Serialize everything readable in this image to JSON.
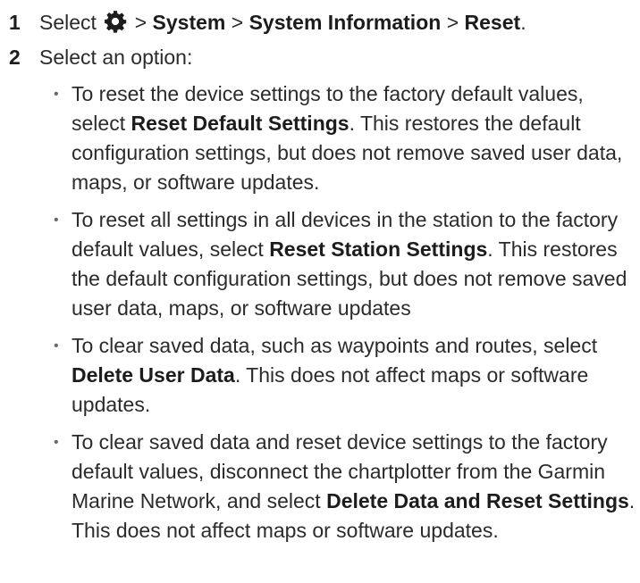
{
  "step1": {
    "number": "1",
    "select": "Select",
    "gear_icon": "gear-icon",
    "sep1": ">",
    "system": "System",
    "sep2": ">",
    "system_info": "System Information",
    "sep3": ">",
    "reset": "Reset",
    "end": "."
  },
  "step2": {
    "number": "2",
    "text": "Select an option:",
    "options": [
      {
        "before": "To reset the device settings to the factory default values, select ",
        "bold": "Reset Default Settings",
        "after": ". This restores the default configuration settings, but does not remove saved user data, maps, or software updates."
      },
      {
        "before": "To reset all settings in all devices in the station to the factory default values, select ",
        "bold": "Reset Station Settings",
        "after": ". This restores the default configuration settings, but does not remove saved user data, maps, or software updates"
      },
      {
        "before": "To clear saved data, such as waypoints and routes, select ",
        "bold": "Delete User Data",
        "after": ". This does not affect maps or software updates."
      },
      {
        "before": "To clear saved data and reset device settings to the factory default values, disconnect the chartplotter from the Garmin Marine Network, and select ",
        "bold": "Delete Data and Reset Settings",
        "after": ". This does not affect maps or software updates."
      }
    ]
  },
  "bullet_char": "•"
}
